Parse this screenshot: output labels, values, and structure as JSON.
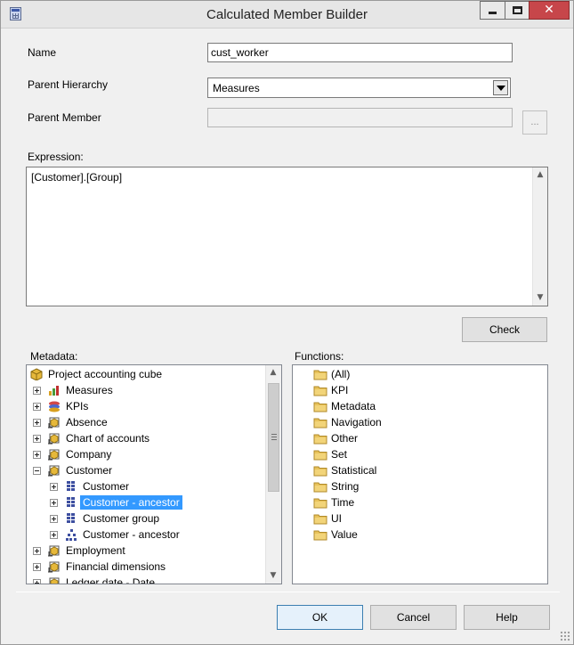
{
  "window": {
    "title": "Calculated Member Builder",
    "close_glyph": "✕"
  },
  "form": {
    "name_label": "Name",
    "name_value": "cust_worker",
    "parent_hierarchy_label": "Parent Hierarchy",
    "parent_hierarchy_value": "Measures",
    "parent_member_label": "Parent Member",
    "parent_member_value": "",
    "ellipsis_label": "...",
    "expression_label": "Expression:",
    "expression_value": "[Customer].[Group]",
    "check_label": "Check"
  },
  "metadata": {
    "label": "Metadata:",
    "items": [
      {
        "label": "Project accounting cube",
        "icon": "cube-icon",
        "level": 0,
        "expander": "none"
      },
      {
        "label": "Measures",
        "icon": "measures-chart-icon",
        "level": 1,
        "expander": "plus"
      },
      {
        "label": "KPIs",
        "icon": "kpi-icon",
        "level": 1,
        "expander": "plus"
      },
      {
        "label": "Absence",
        "icon": "dimension-icon",
        "level": 1,
        "expander": "plus"
      },
      {
        "label": "Chart of accounts",
        "icon": "dimension-icon",
        "level": 1,
        "expander": "plus"
      },
      {
        "label": "Company",
        "icon": "dimension-icon",
        "level": 1,
        "expander": "plus"
      },
      {
        "label": "Customer",
        "icon": "dimension-icon",
        "level": 1,
        "expander": "minus"
      },
      {
        "label": "Customer",
        "icon": "attribute-grid-icon",
        "level": 2,
        "expander": "plus"
      },
      {
        "label": "Customer - ancestor",
        "icon": "attribute-grid-icon",
        "level": 2,
        "expander": "plus",
        "selected": true
      },
      {
        "label": "Customer group",
        "icon": "attribute-grid-icon",
        "level": 2,
        "expander": "plus"
      },
      {
        "label": "Customer - ancestor",
        "icon": "hierarchy-icon",
        "level": 2,
        "expander": "plus"
      },
      {
        "label": "Employment",
        "icon": "dimension-icon",
        "level": 1,
        "expander": "plus"
      },
      {
        "label": "Financial dimensions",
        "icon": "dimension-icon",
        "level": 1,
        "expander": "plus"
      },
      {
        "label": "Ledger date - Date",
        "icon": "dimension-icon",
        "level": 1,
        "expander": "plus"
      }
    ]
  },
  "functions": {
    "label": "Functions:",
    "items": [
      {
        "label": "(All)",
        "icon": "folder-icon"
      },
      {
        "label": "KPI",
        "icon": "folder-icon"
      },
      {
        "label": "Metadata",
        "icon": "folder-icon"
      },
      {
        "label": "Navigation",
        "icon": "folder-icon"
      },
      {
        "label": "Other",
        "icon": "folder-icon"
      },
      {
        "label": "Set",
        "icon": "folder-icon"
      },
      {
        "label": "Statistical",
        "icon": "folder-icon"
      },
      {
        "label": "String",
        "icon": "folder-icon"
      },
      {
        "label": "Time",
        "icon": "folder-icon"
      },
      {
        "label": "UI",
        "icon": "folder-icon"
      },
      {
        "label": "Value",
        "icon": "folder-icon"
      }
    ]
  },
  "footer": {
    "ok_label": "OK",
    "cancel_label": "Cancel",
    "help_label": "Help"
  },
  "colors": {
    "selection": "#3399ff",
    "folder": "#e8c25a",
    "cube": "#e6b83a",
    "grid": "#3d4fa0"
  }
}
